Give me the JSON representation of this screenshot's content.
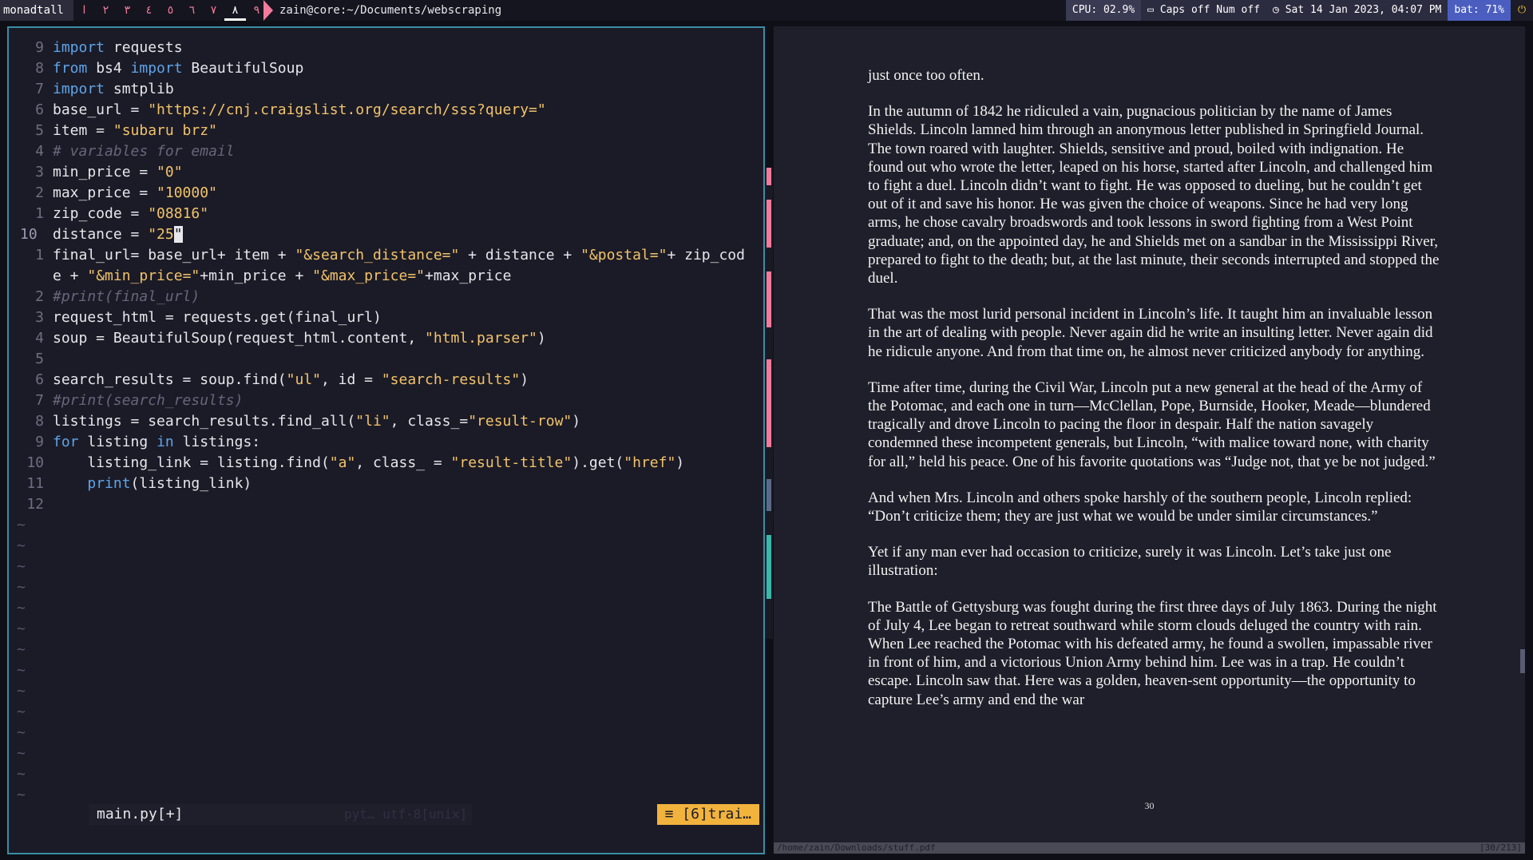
{
  "topbar": {
    "layout": "monadtall",
    "workspaces": [
      "ا",
      "٢",
      "٣",
      "٤",
      "٥",
      "٦",
      "٧",
      "٨",
      "٩"
    ],
    "active_workspace_index": 7,
    "window_title": "zain@core:~/Documents/webscraping",
    "cpu": "CPU: 02.9%",
    "keyboard": "Caps off Num off",
    "clock": "Sat 14 Jan 2023, 04:07 PM",
    "battery": "bat: 71%"
  },
  "editor": {
    "lines": [
      {
        "n": "9",
        "html": "<span class=\"kw\">import</span> requests"
      },
      {
        "n": "8",
        "html": "<span class=\"kw\">from</span> bs4 <span class=\"kw\">import</span> BeautifulSoup"
      },
      {
        "n": "7",
        "html": "<span class=\"kw\">import</span> smtplib"
      },
      {
        "n": "6",
        "html": "base_url = <span class=\"str\">\"https://cnj.craigslist.org/search/sss?query=\"</span>"
      },
      {
        "n": "5",
        "html": "item = <span class=\"str\">\"subaru brz\"</span>"
      },
      {
        "n": "4",
        "html": "<span class=\"cm\"># variables for email</span>"
      },
      {
        "n": "3",
        "html": "min_price = <span class=\"str\">\"0\"</span>"
      },
      {
        "n": "2",
        "html": "max_price = <span class=\"str\">\"10000\"</span>"
      },
      {
        "n": "1",
        "html": "zip_code = <span class=\"str\">\"08816\"</span>"
      },
      {
        "n": "10",
        "cur": true,
        "html": "distance = <span class=\"str\">\"25<span class=\"cursor\">\"</span></span>"
      },
      {
        "n": "1",
        "html": "final_url= base_url+ item + <span class=\"str\">\"&amp;search_distance=\"</span> + distance + <span class=\"str\">\"&amp;postal=\"</span>+ zip_cod"
      },
      {
        "n": "",
        "html": "e + <span class=\"str\">\"&amp;min_price=\"</span>+min_price + <span class=\"str\">\"&amp;max_price=\"</span>+max_price"
      },
      {
        "n": "2",
        "html": "<span class=\"cm\">#print(final_url)</span>"
      },
      {
        "n": "3",
        "html": "request_html = requests.get(final_url)"
      },
      {
        "n": "4",
        "html": "soup = BeautifulSoup(request_html.content, <span class=\"str\">\"html.parser\"</span>)"
      },
      {
        "n": "5",
        "html": ""
      },
      {
        "n": "6",
        "html": "search_results = soup.find(<span class=\"str\">\"ul\"</span>, id = <span class=\"str\">\"search-results\"</span>)"
      },
      {
        "n": "7",
        "html": "<span class=\"cm\">#print(search_results)</span>"
      },
      {
        "n": "8",
        "html": "listings = search_results.find_all(<span class=\"str\">\"li\"</span>, class_=<span class=\"str\">\"result-row\"</span>)"
      },
      {
        "n": "9",
        "html": "<span class=\"kw\">for</span> listing <span class=\"kw\">in</span> listings:"
      },
      {
        "n": "10",
        "html": "    listing_link = listing.find(<span class=\"str\">\"a\"</span>, class_ = <span class=\"str\">\"result-title\"</span>).get(<span class=\"str\">\"href\"</span>)"
      },
      {
        "n": "11",
        "html": "    <span class=\"kw\">print</span>(listing_link)"
      },
      {
        "n": "12",
        "html": ""
      }
    ],
    "tilde_count": 14,
    "tilde_char": "~",
    "status_file": "main.py[+]",
    "status_filetype": "pyt… utf-8[unix]",
    "status_trail": "≡ [6]trai…"
  },
  "pdf": {
    "paragraphs": [
      "just once too often.",
      "In the autumn of 1842 he ridiculed a vain, pugnacious politician by the name of James Shields. Lincoln lamned him through an anonymous letter published in Springfield Journal. The town roared with laughter. Shields, sensitive and proud, boiled with indignation. He found out who wrote the letter, leaped on his horse, started after Lincoln, and challenged him to fight a duel. Lincoln didn’t want to fight. He was opposed to dueling, but he couldn’t get out of it and save his honor. He was given the choice of weapons. Since he had very long arms, he chose cavalry broadswords and took lessons in sword fighting from a West Point graduate; and, on the appointed day, he and Shields met on a sandbar in the Mississippi River, prepared to fight to the death; but, at the last minute, their seconds interrupted and stopped the duel.",
      "That was the most lurid personal incident in Lincoln’s life. It taught him an invaluable lesson in the art of dealing with people. Never again did he write an insulting letter. Never again did he ridicule anyone. And from that time on, he almost never criticized anybody for anything.",
      "Time after time, during the Civil War, Lincoln put a new general at the head of the Army of the Potomac, and each one in turn—McClellan, Pope, Burnside, Hooker, Meade—blundered tragically and drove Lincoln to pacing the floor in despair. Half the nation savagely condemned these incompetent generals, but Lincoln, “with malice toward none, with charity for all,” held his peace. One of his favorite quotations was “Judge not, that ye be not judged.”",
      "And when Mrs. Lincoln and others spoke harshly of the southern people, Lincoln replied: “Don’t criticize them; they are just what we would be under similar circumstances.”",
      "Yet if any man ever had occasion to criticize, surely it was Lincoln. Let’s take just one illustration:",
      "The Battle of Gettysburg was fought during the first three days of July 1863. During the night of July 4, Lee began to retreat southward while storm clouds deluged the country with rain. When Lee reached the Potomac with his defeated army, he found a swollen, impassable river in front of him, and a victorious Union Army behind him. Lee was in a trap. He couldn’t escape. Lincoln saw that. Here was a golden, heaven-sent opportunity—the opportunity to capture Lee’s army and end the war"
    ],
    "page_number": "30",
    "path": "/home/zain/Downloads/stuff.pdf",
    "position": "[30/213]"
  },
  "colors": {
    "accent_pink": "#f37a9a",
    "editor_border": "#3a8da3",
    "string": "#f2c36a",
    "keyword": "#5ea4e8",
    "status_trail": "#f2b33d",
    "battery_bg": "#4b5ec0"
  },
  "icons": {
    "keyboard": "keyboard-icon",
    "clock": "clock-icon",
    "power": "power-icon"
  }
}
